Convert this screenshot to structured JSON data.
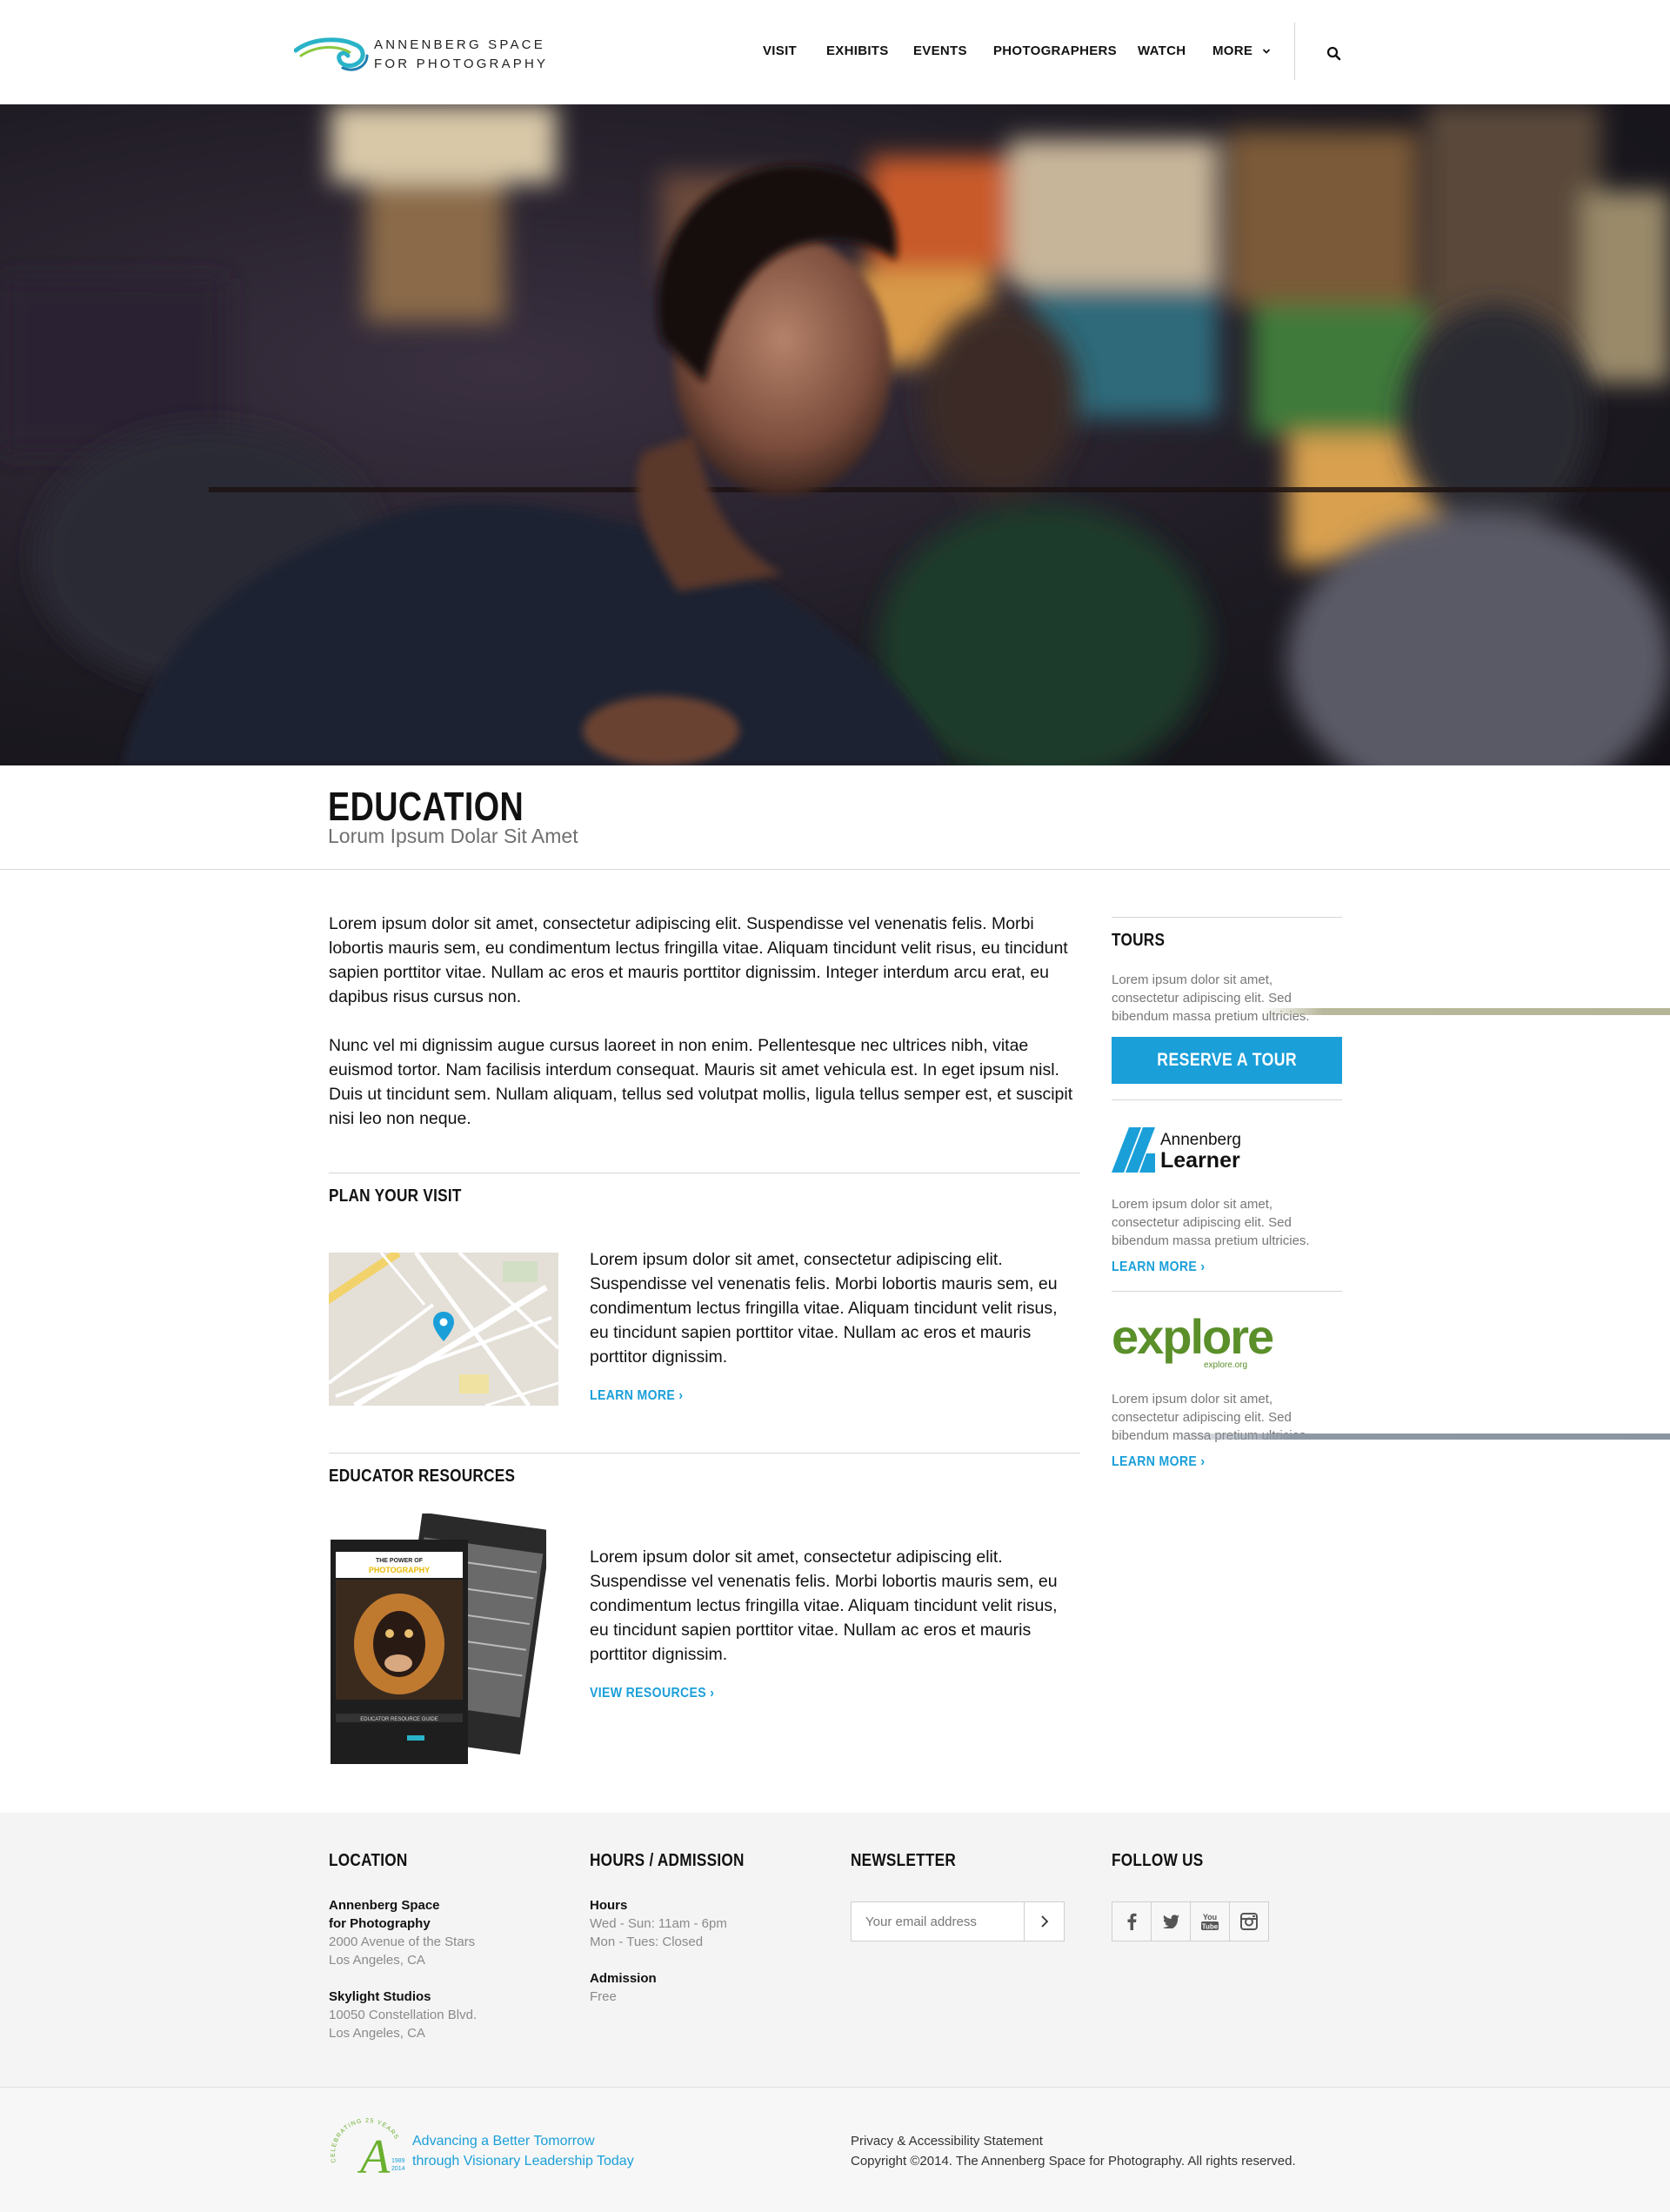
{
  "header": {
    "logo_line1": "ANNENBERG SPACE",
    "logo_line2": "FOR PHOTOGRAPHY",
    "nav": [
      {
        "label": "VISIT"
      },
      {
        "label": "EXHIBITS"
      },
      {
        "label": "EVENTS"
      },
      {
        "label": "PHOTOGRAPHERS"
      },
      {
        "label": "WATCH"
      },
      {
        "label": "MORE"
      }
    ]
  },
  "page": {
    "title": "EDUCATION",
    "subtitle": "Lorum Ipsum Dolar Sit Amet"
  },
  "main": {
    "paragraph1": "Lorem ipsum dolor sit amet, consectetur adipiscing elit. Suspendisse vel venenatis felis. Morbi lobortis mauris sem, eu condimentum lectus fringilla vitae. Aliquam tincidunt velit risus, eu tincidunt sapien porttitor vitae. Nullam ac eros et mauris porttitor dignissim. Integer interdum arcu erat, eu dapibus risus cursus non.",
    "paragraph2": "Nunc vel mi dignissim augue cursus laoreet in non enim. Pellentesque nec ultrices nibh, vitae euismod tortor. Nam facilisis interdum consequat. Mauris sit amet vehicula est. In eget ipsum nisl. Duis ut tincidunt sem. Nullam aliquam, tellus sed volutpat mollis, ligula tellus semper est, et suscipit nisi leo non neque.",
    "plan_visit": {
      "heading": "PLAN YOUR VISIT",
      "text": "Lorem ipsum dolor sit amet, consectetur adipiscing elit. Suspendisse vel venenatis felis. Morbi lobortis mauris sem, eu condimentum lectus fringilla vitae. Aliquam tincidunt velit risus, eu tincidunt sapien porttitor vitae. Nullam ac eros et mauris porttitor dignissim.",
      "link": "LEARN MORE  ›"
    },
    "educator_resources": {
      "heading": "EDUCATOR RESOURCES",
      "text": "Lorem ipsum dolor sit amet, consectetur adipiscing elit. Suspendisse vel venenatis felis. Morbi lobortis mauris sem, eu condimentum lectus fringilla vitae. Aliquam tincidunt velit risus, eu tincidunt sapien porttitor vitae. Nullam ac eros et mauris porttitor dignissim.",
      "link": "VIEW RESOURCES  ›"
    }
  },
  "sidebar": {
    "tours_heading": "TOURS",
    "tours_text": "Lorem ipsum dolor sit amet, consectetur adipiscing elit. Sed bibendum massa pretium ultricies.",
    "reserve_button": "RESERVE A TOUR",
    "learner_logo_line1": "Annenberg",
    "learner_logo_line2": "Learner",
    "learner_text": "Lorem ipsum dolor sit amet, consectetur adipiscing elit. Sed bibendum massa pretium ultricies.",
    "learner_link": "LEARN MORE  ›",
    "explore_logo": "explore",
    "explore_sub": "explore.org",
    "explore_text": "Lorem ipsum dolor sit amet, consectetur adipiscing elit. Sed bibendum massa pretium ultricies.",
    "explore_link": "LEARN MORE  ›"
  },
  "brochure": {
    "title_line1": "THE POWER OF",
    "title_line2": "PHOTOGRAPHY",
    "footer_label": "EDUCATOR RESOURCE GUIDE"
  },
  "footer": {
    "location": {
      "heading": "LOCATION",
      "venue1_name_line1": "Annenberg Space",
      "venue1_name_line2": "for Photography",
      "venue1_addr_line1": "2000 Avenue of the Stars",
      "venue1_addr_line2": "Los Angeles, CA",
      "venue2_name": "Skylight Studios",
      "venue2_addr_line1": "10050 Constellation Blvd.",
      "venue2_addr_line2": "Los Angeles, CA"
    },
    "hours": {
      "heading": "HOURS / ADMISSION",
      "hours_label": "Hours",
      "hours_line1": "Wed - Sun: 11am - 6pm",
      "hours_line2": "Mon - Tues: Closed",
      "admission_label": "Admission",
      "admission_value": "Free"
    },
    "newsletter": {
      "heading": "NEWSLETTER",
      "placeholder": "Your email address"
    },
    "follow": {
      "heading": "FOLLOW US",
      "youtube_label_top": "You",
      "youtube_label_bottom": "Tube"
    },
    "anniversary": {
      "arc_text": "CELEBRATING 25 YEARS",
      "years_top": "1989",
      "years_bottom": "2014",
      "letter": "A"
    },
    "tagline_line1": "Advancing a Better Tomorrow",
    "tagline_line2": "through Visionary Leadership Today",
    "privacy_link": "Privacy & Accessibility Statement",
    "copyright": "Copyright ©2014. The Annenberg Space for Photography. All rights reserved."
  },
  "colors": {
    "accent": "#1a9fd9",
    "explore_green": "#5a8f2a",
    "footer_bg": "#f4f4f4"
  },
  "icons": {
    "search": "search-icon",
    "more_chevron": "chevron-down-icon",
    "email_submit": "chevron-right-icon",
    "social": [
      "facebook-icon",
      "twitter-icon",
      "youtube-icon",
      "instagram-icon"
    ],
    "map_pin": "map-pin-icon"
  }
}
